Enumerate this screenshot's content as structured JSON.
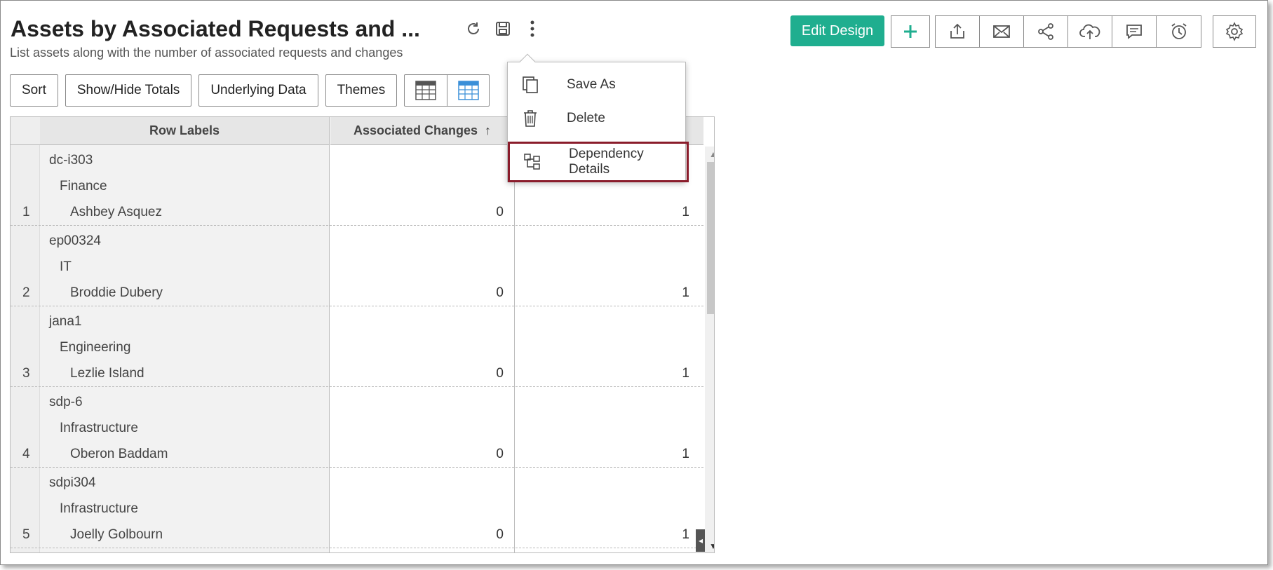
{
  "report": {
    "title": "Assets by Associated Requests and ...",
    "subtitle": "List assets along with the number of associated requests and changes"
  },
  "title_icons": [
    "refresh-icon",
    "save-icon",
    "more-options-icon"
  ],
  "toolbar": {
    "edit_label": "Edit Design",
    "add_icon": "plus-icon",
    "share_icons": [
      "export-icon",
      "email-icon",
      "share-icon",
      "publish-icon",
      "comment-icon",
      "schedule-alarm-icon"
    ],
    "settings_icon": "gear-icon",
    "accent": "#1fae8f"
  },
  "actions": {
    "sort": "Sort",
    "totals": "Show/Hide Totals",
    "underlying": "Underlying Data",
    "themes": "Themes"
  },
  "view_toggle": [
    "tabular-view-icon",
    "compact-view-icon"
  ],
  "menu": {
    "items": [
      {
        "label": "Save As",
        "icon": "copy-icon"
      },
      {
        "label": "Delete",
        "icon": "trash-icon"
      },
      {
        "label": "Dependency Details",
        "icon": "dependency-icon",
        "highlighted": true
      }
    ],
    "highlight_color": "#8a1c2b"
  },
  "table": {
    "headers": [
      "Row Labels",
      "Associated Changes"
    ],
    "rows": [
      {
        "index": "1",
        "asset": "dc-i303",
        "department": "Finance",
        "user": "Ashbey Asquez",
        "changes": "0",
        "requests": "1"
      },
      {
        "index": "2",
        "asset": "ep00324",
        "department": "IT",
        "user": "Broddie Dubery",
        "changes": "0",
        "requests": "1"
      },
      {
        "index": "3",
        "asset": "jana1",
        "department": "Engineering",
        "user": "Lezlie Island",
        "changes": "0",
        "requests": "1"
      },
      {
        "index": "4",
        "asset": "sdp-6",
        "department": "Infrastructure",
        "user": "Oberon Baddam",
        "changes": "0",
        "requests": "1"
      },
      {
        "index": "5",
        "asset": "sdpi304",
        "department": "Infrastructure",
        "user": "Joelly Golbourn",
        "changes": "0",
        "requests": "1"
      }
    ]
  }
}
